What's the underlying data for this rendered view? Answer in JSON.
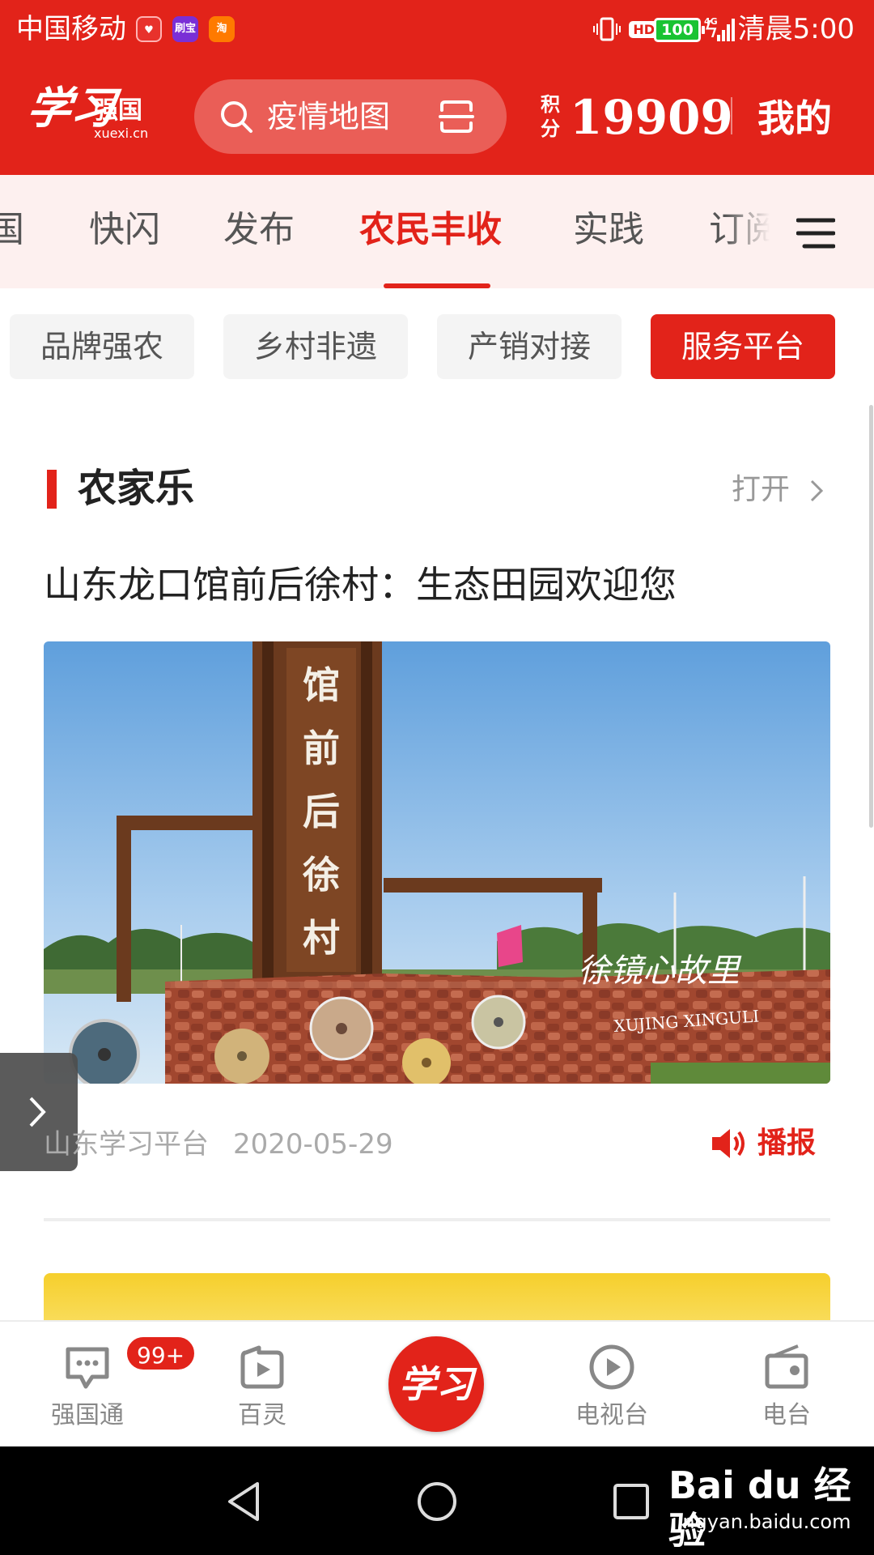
{
  "status_bar": {
    "carrier": "中国移动",
    "apps": [
      "刷宝",
      "淘"
    ],
    "hd": "HD",
    "network": "4G",
    "battery": "100",
    "time": "清晨5:00"
  },
  "header": {
    "logo_script": "学习",
    "logo_name": "强国",
    "logo_domain": "xuexi.cn",
    "search_placeholder": "疫情地图",
    "points_label": "积分",
    "points_value": "19909",
    "mine_label": "我的"
  },
  "tabs": {
    "items": [
      "国",
      "快闪",
      "发布",
      "农民丰收",
      "实践",
      "订阅"
    ],
    "active": "农民丰收"
  },
  "chips": {
    "items": [
      "品牌强农",
      "乡村非遗",
      "产销对接",
      "服务平台"
    ],
    "selected": "服务平台"
  },
  "section": {
    "title": "农家乐",
    "open_label": "打开"
  },
  "article": {
    "title": "山东龙口馆前后徐村：生态田园欢迎您",
    "photo_sign_vertical": "馆前后徐村",
    "photo_sign_cn": "徐镜心故里",
    "photo_sign_en": "XUJING XINGULI",
    "source": "山东学习平台",
    "date": "2020-05-29",
    "broadcast_label": "播报"
  },
  "bottom_nav": {
    "items": [
      {
        "label": "强国通",
        "icon": "chat-icon",
        "badge": "99+"
      },
      {
        "label": "百灵",
        "icon": "video-play-icon"
      },
      {
        "label": "学习",
        "icon": "xuexi-logo"
      },
      {
        "label": "电视台",
        "icon": "tv-play-icon"
      },
      {
        "label": "电台",
        "icon": "radio-icon"
      }
    ]
  },
  "watermark": {
    "brand": "Bai du 经验",
    "url": "jingyan.baidu.com"
  },
  "colors": {
    "brand_red": "#e2231a",
    "tab_bg": "#fdf0ef",
    "chip_bg": "#f4f4f4"
  }
}
